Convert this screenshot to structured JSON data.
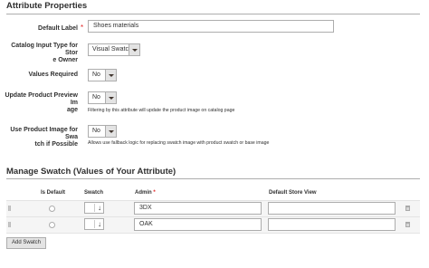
{
  "attribute_properties": {
    "title": "Attribute Properties",
    "default_label": {
      "label": "Default Label",
      "value": "Shoes materials"
    },
    "catalog_input_type": {
      "label_line1": "Catalog Input Type for Stor",
      "label_line2": "e Owner",
      "value": "Visual Swatch"
    },
    "values_required": {
      "label": "Values Required",
      "value": "No"
    },
    "update_preview_image": {
      "label_line1": "Update Product Preview Im",
      "label_line2": "age",
      "value": "No",
      "note": "Filtering by this attribute will update the product image on catalog page"
    },
    "use_product_image": {
      "label_line1": "Use Product Image for Swa",
      "label_line2": "tch if Possible",
      "value": "No",
      "note": "Allows use fallback logic for replacing swatch image with product swatch or base image"
    }
  },
  "manage_swatch": {
    "title": "Manage Swatch (Values of Your Attribute)",
    "columns": {
      "is_default": "Is Default",
      "swatch": "Swatch",
      "admin": "Admin",
      "admin_required": "*",
      "default_store_view": "Default Store View"
    },
    "rows": [
      {
        "admin": "3DX",
        "store_view": "",
        "swatch_arrow": "↓"
      },
      {
        "admin": "OAK",
        "store_view": "",
        "swatch_arrow": "↓"
      }
    ],
    "add_button": "Add Swatch"
  },
  "required_star": "*",
  "colors": {
    "required": "#e22626",
    "border": "#adadad",
    "button_bg": "#e3e3e3"
  }
}
